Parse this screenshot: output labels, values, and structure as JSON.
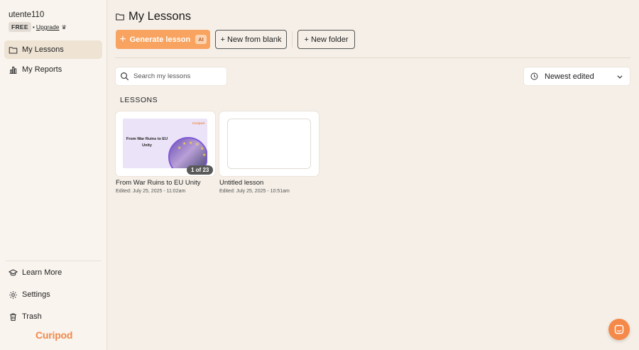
{
  "user": {
    "name": "utente110",
    "plan": "FREE",
    "separator": "•",
    "upgrade": "Upgrade",
    "crown_icon": "♛"
  },
  "sidebar": {
    "items": [
      {
        "label": "My Lessons",
        "icon": "folder-icon",
        "active": true
      },
      {
        "label": "My Reports",
        "icon": "bar-chart-icon",
        "active": false
      }
    ],
    "bottom_items": [
      {
        "label": "Learn More",
        "icon": "graduation-cap-icon"
      },
      {
        "label": "Settings",
        "icon": "gear-icon"
      },
      {
        "label": "Trash",
        "icon": "trash-icon"
      }
    ],
    "logo": "Curipod"
  },
  "main": {
    "title": "My Lessons",
    "buttons": {
      "generate": "Generate lesson",
      "generate_badge": "AI",
      "new_blank": "+ New from blank",
      "new_folder": "+ New folder"
    },
    "search": {
      "placeholder": "Search my lessons"
    },
    "sort": {
      "selected": "Newest edited"
    },
    "section_label": "LESSONS",
    "lessons": [
      {
        "title": "From War Ruins to EU Unity",
        "edited": "Edited: July 25, 2025 - 11:02am",
        "thumb_title": "From War Ruins to EU Unity",
        "thumb_logo": "Curipod",
        "page_badge": "1 of 23"
      },
      {
        "title": "Untitled lesson",
        "edited": "Edited: July 25, 2025 - 10:51am"
      }
    ]
  },
  "colors": {
    "accent": "#f8a35f",
    "brand": "#f08a4b",
    "background": "#f5efe7",
    "sidebar": "#f9f4ee"
  }
}
